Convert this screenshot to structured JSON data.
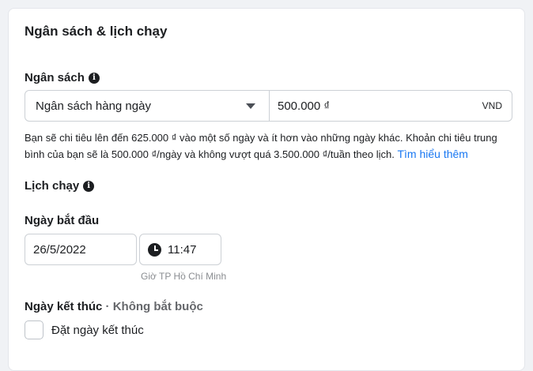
{
  "card": {
    "title": "Ngân sách & lịch chạy"
  },
  "budget": {
    "label": "Ngân sách",
    "info_icon": "i",
    "type_value": "Ngân sách hàng ngày",
    "amount_value": "500.000 ₫",
    "currency": "VND",
    "description": "Bạn sẽ chi tiêu lên đến 625.000 ₫ vào một số ngày và ít hơn vào những ngày khác. Khoản chi tiêu trung bình của bạn sẽ là 500.000 ₫/ngày và không vượt quá 3.500.000 ₫/tuần theo lịch.",
    "learn_more": "Tìm hiểu thêm"
  },
  "schedule": {
    "label": "Lịch chạy",
    "info_icon": "i",
    "start_label": "Ngày bắt đầu",
    "start_date": "26/5/2022",
    "start_time": "11:47",
    "timezone": "Giờ TP Hồ Chí Minh",
    "end_label": "Ngày kết thúc",
    "end_optional": "· Không bắt buộc",
    "end_checkbox_label": "Đặt ngày kết thúc",
    "end_checked": false
  }
}
